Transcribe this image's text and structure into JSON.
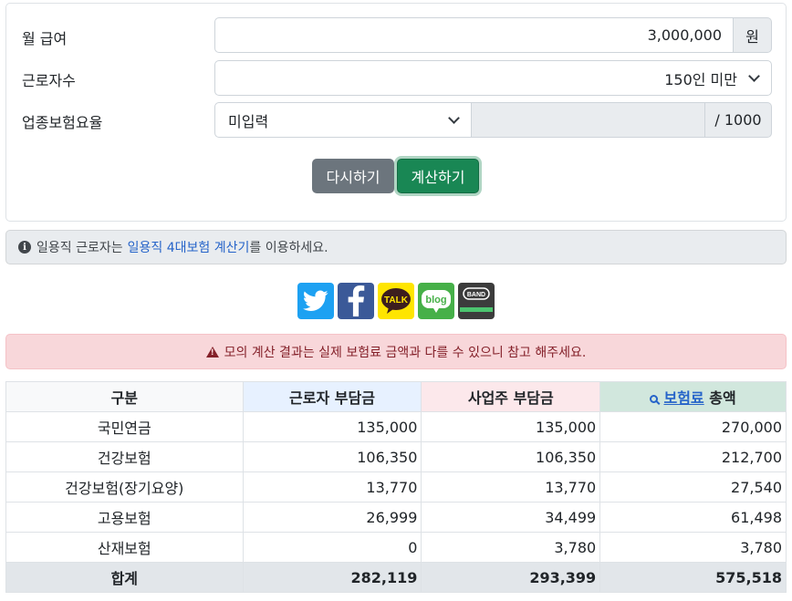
{
  "form": {
    "salary_label": "월 급여",
    "salary_value": "3,000,000",
    "salary_unit": "원",
    "workers_label": "근로자수",
    "workers_value": "150인 미만",
    "industry_label": "업종보험요율",
    "industry_value": "미입력",
    "industry_unit": "/ 1000"
  },
  "buttons": {
    "reset": "다시하기",
    "calc": "계산하기"
  },
  "info": {
    "prefix": "일용직 근로자는",
    "link": "일용직 4대보험 계산기",
    "suffix": "를 이용하세요."
  },
  "share": {
    "kakao": "TALK",
    "blog": "blog",
    "band": "BAND"
  },
  "alert": {
    "text": "모의 계산 결과는 실제 보험료 금액과 다를 수 있으니 참고 해주세요."
  },
  "table": {
    "headers": {
      "category": "구분",
      "employee": "근로자 부담금",
      "employer": "사업주 부담금",
      "total_link": "보험료",
      "total_suffix": "총액"
    },
    "rows": [
      {
        "name": "국민연금",
        "employee": "135,000",
        "employer": "135,000",
        "total": "270,000"
      },
      {
        "name": "건강보험",
        "employee": "106,350",
        "employer": "106,350",
        "total": "212,700"
      },
      {
        "name": "건강보험(장기요양)",
        "employee": "13,770",
        "employer": "13,770",
        "total": "27,540"
      },
      {
        "name": "고용보험",
        "employee": "26,999",
        "employer": "34,499",
        "total": "61,498"
      },
      {
        "name": "산재보험",
        "employee": "0",
        "employer": "3,780",
        "total": "3,780"
      }
    ],
    "total_row": {
      "name": "합계",
      "employee": "282,119",
      "employer": "293,399",
      "total": "575,518"
    }
  }
}
